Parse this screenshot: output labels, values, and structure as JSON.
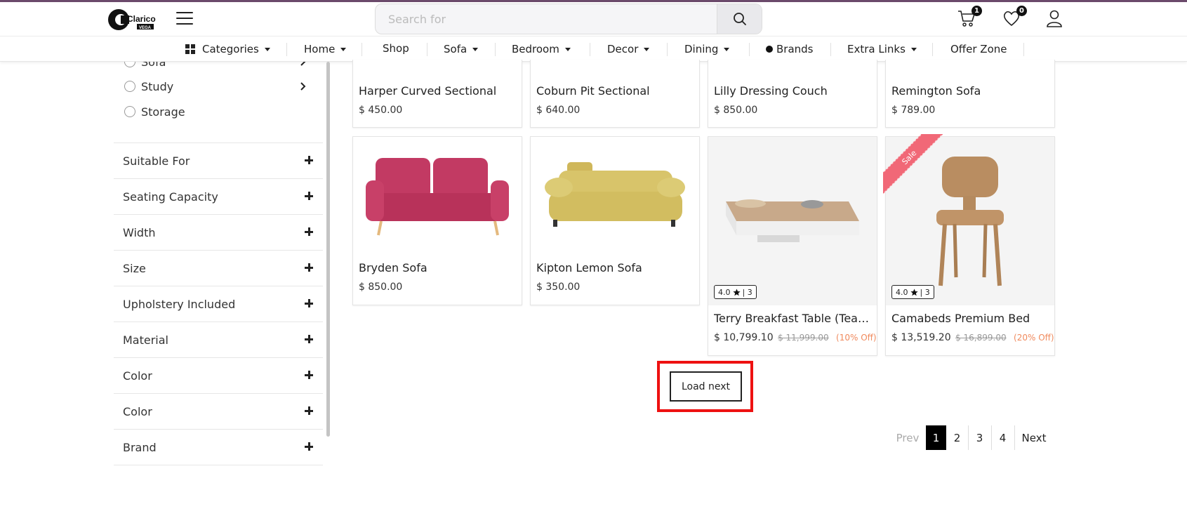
{
  "header": {
    "logo_text": "Clarico",
    "logo_subtext": "VEGA",
    "search_placeholder": "Search for",
    "cart_count": "1",
    "wishlist_count": "0"
  },
  "nav": {
    "categories": "Categories",
    "home": "Home",
    "shop": "Shop",
    "sofa": "Sofa",
    "bedroom": "Bedroom",
    "decor": "Decor",
    "dining": "Dining",
    "brands": "Brands",
    "extra_links": "Extra Links",
    "offer_zone": "Offer Zone"
  },
  "sidebar": {
    "categories": [
      {
        "label": "Sofa",
        "has_children": true
      },
      {
        "label": "Study",
        "has_children": true
      },
      {
        "label": "Storage",
        "has_children": false
      }
    ],
    "facets": [
      "Suitable For",
      "Seating Capacity",
      "Width",
      "Size",
      "Upholstery Included",
      "Material",
      "Color",
      "Color",
      "Brand"
    ]
  },
  "products_row1": [
    {
      "name": "Harper Curved Sectional",
      "price": "$ 450.00"
    },
    {
      "name": "Coburn Pit Sectional",
      "price": "$ 640.00"
    },
    {
      "name": "Lilly Dressing Couch",
      "price": "$ 850.00"
    },
    {
      "name": "Remington Sofa",
      "price": "$ 789.00"
    }
  ],
  "products_row2": [
    {
      "name": "Bryden Sofa",
      "price": "$ 850.00"
    },
    {
      "name": "Kipton Lemon Sofa",
      "price": "$ 350.00"
    },
    {
      "name": "Terry Breakfast Table (Teak...",
      "price": "$ 10,799.10",
      "old_price": "$ 11,999.00",
      "discount": "(10% Off)",
      "rating": "4.0",
      "reviews": "| 3"
    },
    {
      "name": "Camabeds Premium Bed",
      "price": "$ 13,519.20",
      "old_price": "$ 16,899.00",
      "discount": "(20% Off)",
      "rating": "4.0",
      "reviews": "| 3",
      "badge": "Sale"
    }
  ],
  "load_next": "Load next",
  "pagination": {
    "prev": "Prev",
    "pages": [
      "1",
      "2",
      "3",
      "4"
    ],
    "current": "1",
    "next": "Next"
  },
  "colors": {
    "accent_sale": "#f16877",
    "discount": "#f08a5d",
    "highlight": "#ee1111"
  }
}
